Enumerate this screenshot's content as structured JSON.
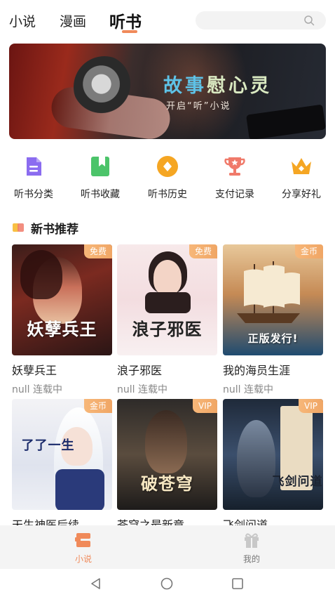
{
  "top_tabs": [
    "小说",
    "漫画",
    "听书"
  ],
  "active_tab": "听书",
  "search": {
    "placeholder": ""
  },
  "banner": {
    "headline_part1": "故事",
    "headline_part2": "慰心灵",
    "subline": "开启“听”小说"
  },
  "quick_menu": [
    {
      "label": "听书分类",
      "icon": "category-icon",
      "color": "#8b6cf0"
    },
    {
      "label": "听书收藏",
      "icon": "bookmark-icon",
      "color": "#4cc46a"
    },
    {
      "label": "听书历史",
      "icon": "history-icon",
      "color": "#f5a623"
    },
    {
      "label": "支付记录",
      "icon": "trophy-icon",
      "color": "#f07a6a"
    },
    {
      "label": "分享好礼",
      "icon": "crown-icon",
      "color": "#f5a623"
    }
  ],
  "section": {
    "title": "新书推荐"
  },
  "books": [
    {
      "title": "妖孽兵王",
      "status": "null 连载中",
      "badge": "免费",
      "cover_text": "妖孽兵王"
    },
    {
      "title": "浪子邪医",
      "status": "null 连载中",
      "badge": "免费",
      "cover_text": "浪子邪医"
    },
    {
      "title": "我的海员生涯",
      "status": "null 连载中",
      "badge": "金币",
      "cover_text": "正版发行!"
    },
    {
      "title": "天生神医后续",
      "status": "",
      "badge": "金币",
      "cover_text": "了了一生"
    },
    {
      "title": "苍穹之最新章",
      "status": "",
      "badge": "VIP",
      "cover_text": "破苍穹"
    },
    {
      "title": "飞剑问道",
      "status": "",
      "badge": "VIP",
      "cover_text": "飞剑问道"
    }
  ],
  "bottom_nav": [
    {
      "label": "小说",
      "active": true,
      "icon": "book-stack-icon"
    },
    {
      "label": "我的",
      "active": false,
      "icon": "gift-icon"
    }
  ],
  "colors": {
    "accent": "#f08a5a",
    "badge": "#f0a665"
  }
}
